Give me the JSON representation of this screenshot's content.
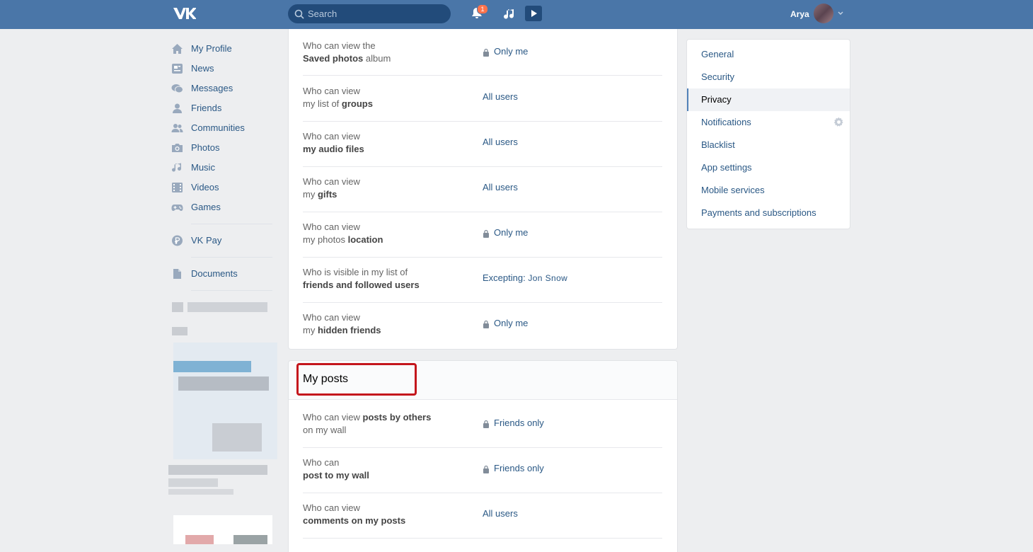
{
  "header": {
    "search_placeholder": "Search",
    "notifications_count": "1",
    "user_name": "Arya"
  },
  "sidebar": {
    "items": [
      {
        "label": "My Profile",
        "icon": "home-icon"
      },
      {
        "label": "News",
        "icon": "news-icon"
      },
      {
        "label": "Messages",
        "icon": "messages-icon"
      },
      {
        "label": "Friends",
        "icon": "friend-icon"
      },
      {
        "label": "Communities",
        "icon": "communities-icon"
      },
      {
        "label": "Photos",
        "icon": "camera-icon"
      },
      {
        "label": "Music",
        "icon": "music-note-icon"
      },
      {
        "label": "Videos",
        "icon": "film-icon"
      },
      {
        "label": "Games",
        "icon": "gamepad-icon"
      },
      {
        "label": "VK Pay",
        "icon": "vkpay-icon"
      },
      {
        "label": "Documents",
        "icon": "document-icon"
      }
    ]
  },
  "privacy": {
    "rows": [
      {
        "q1": "Who can view the",
        "q2b": "Saved photos",
        "q2": " album",
        "value": "Only me"
      },
      {
        "q1": "Who can view",
        "q2": "my list of ",
        "q2b": "groups",
        "value": "All users"
      },
      {
        "q1": "Who can view",
        "q2b": "my audio files",
        "value": "All users"
      },
      {
        "q1": "Who can view",
        "q2": "my ",
        "q2b": "gifts",
        "value": "All users"
      },
      {
        "q1": "Who can view",
        "q2": "my photos ",
        "q2b": "location",
        "value": "Only me"
      },
      {
        "q1": "Who is visible in my list of",
        "q2b": "friends and followed users",
        "value_prefix": "Excepting: ",
        "value_name": "Jon Snow"
      },
      {
        "q1": "Who can view",
        "q2": "my ",
        "q2b": "hidden friends",
        "value": "Only me"
      }
    ]
  },
  "posts": {
    "title": "My posts",
    "rows": [
      {
        "q1": "Who can view ",
        "q1b": "posts by others",
        "q2": "on my wall",
        "value": "Friends only"
      },
      {
        "q1": "Who can",
        "q2b": "post to my wall",
        "value": "Friends only"
      },
      {
        "q1": "Who can view",
        "q2b": "comments on my posts",
        "value": "All users"
      }
    ]
  },
  "settings_menu": {
    "items": [
      "General",
      "Security",
      "Privacy",
      "Notifications",
      "Blacklist",
      "App settings",
      "Mobile services",
      "Payments and subscriptions"
    ],
    "active": "Privacy"
  },
  "colors": {
    "header": "#4a76a8",
    "link": "#2a5885",
    "highlight": "#c4161c"
  }
}
